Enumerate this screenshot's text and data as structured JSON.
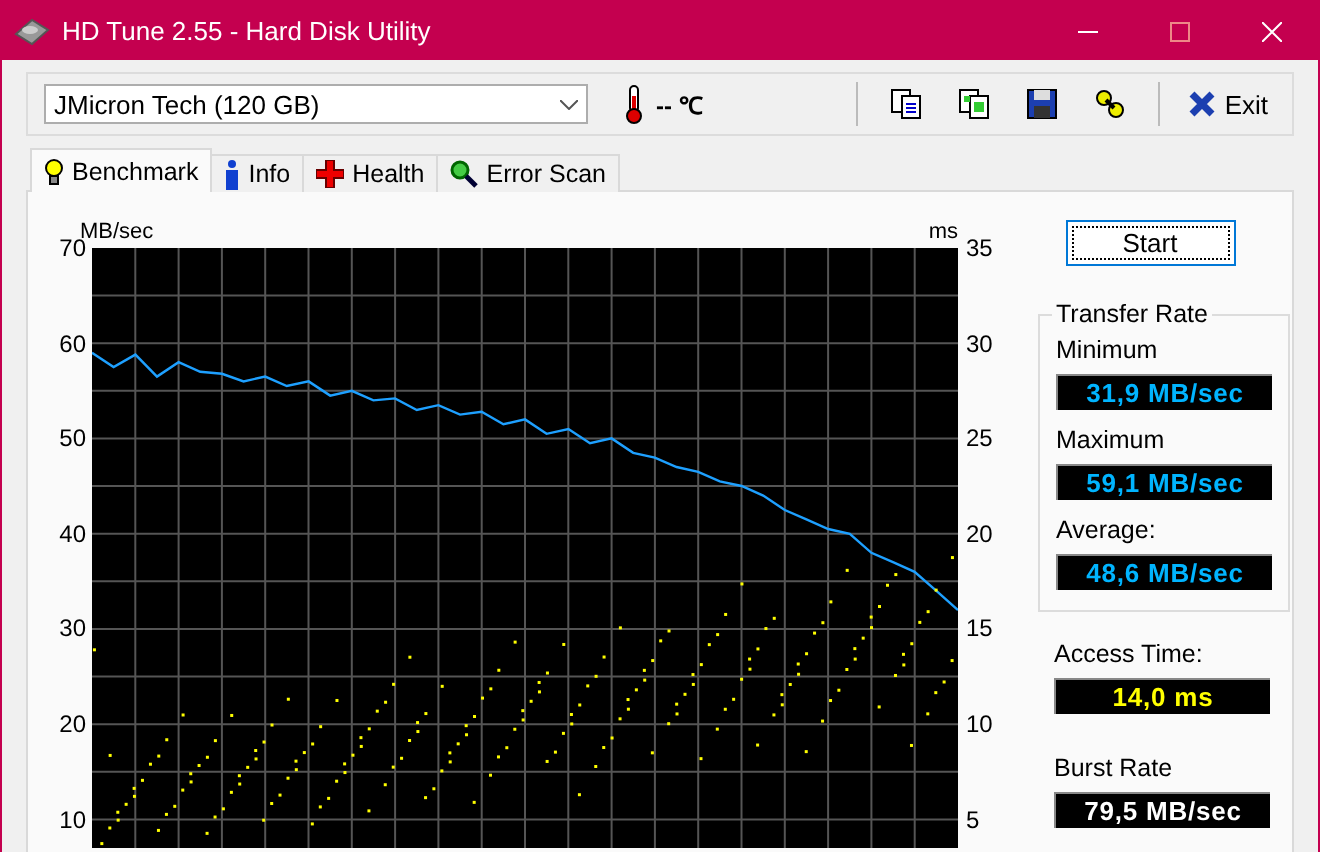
{
  "window": {
    "title": "HD Tune 2.55 - Hard Disk Utility"
  },
  "toolbar": {
    "drive": "JMicron Tech (120 GB)",
    "temperature": "-- ℃",
    "exit": "Exit"
  },
  "tabs": [
    {
      "label": "Benchmark",
      "selected": true,
      "kind": "bulb"
    },
    {
      "label": "Info",
      "selected": false,
      "kind": "info"
    },
    {
      "label": "Health",
      "selected": false,
      "kind": "cross"
    },
    {
      "label": "Error Scan",
      "selected": false,
      "kind": "search"
    }
  ],
  "benchmark": {
    "transfer_chart": {
      "chart_data": {
        "type": "line",
        "grid": true,
        "ylabel": "MB/sec",
        "ylim": [
          7,
          70
        ],
        "yticks": [
          10,
          20,
          30,
          40,
          50,
          60,
          70
        ],
        "categories": [
          null,
          null,
          null,
          null,
          null,
          null,
          null,
          null,
          null,
          null,
          null,
          null,
          null,
          null,
          null,
          null,
          null,
          null,
          null,
          null,
          null,
          null,
          null,
          null,
          null,
          null,
          null,
          null,
          null,
          null,
          null,
          null,
          null,
          null,
          null,
          null,
          null,
          null,
          null,
          null,
          null
        ],
        "series": [
          {
            "color": "#1ea0ff",
            "values": [
              59,
              57.5,
              58.8,
              56.5,
              58,
              57,
              56.8,
              56,
              56.5,
              55.5,
              56,
              54.5,
              55,
              54,
              54.2,
              53,
              53.5,
              52.5,
              52.8,
              51.5,
              52,
              50.5,
              51,
              49.5,
              50,
              48.5,
              48,
              47,
              46.5,
              45.5,
              45,
              44,
              42.5,
              41.5,
              40.5,
              40,
              38,
              37,
              36,
              34,
              32
            ]
          }
        ]
      }
    },
    "access_axis": {
      "unit": "ms",
      "ticks": [
        "35",
        "30",
        "25",
        "20",
        "15",
        "10",
        "5"
      ]
    },
    "start": "Start",
    "transfer_rate": {
      "title": "Transfer Rate",
      "readings": [
        {
          "label": "Minimum",
          "value": "31,9 MB/sec"
        },
        {
          "label": "Maximum",
          "value": "59,1 MB/sec"
        },
        {
          "label": "Average:",
          "value": "48,6 MB/sec"
        }
      ]
    },
    "access_time": {
      "label": "Access Time:",
      "value": "14,0 ms"
    },
    "burst_rate": {
      "label": "Burst Rate",
      "value": "79,5 MB/sec"
    }
  }
}
